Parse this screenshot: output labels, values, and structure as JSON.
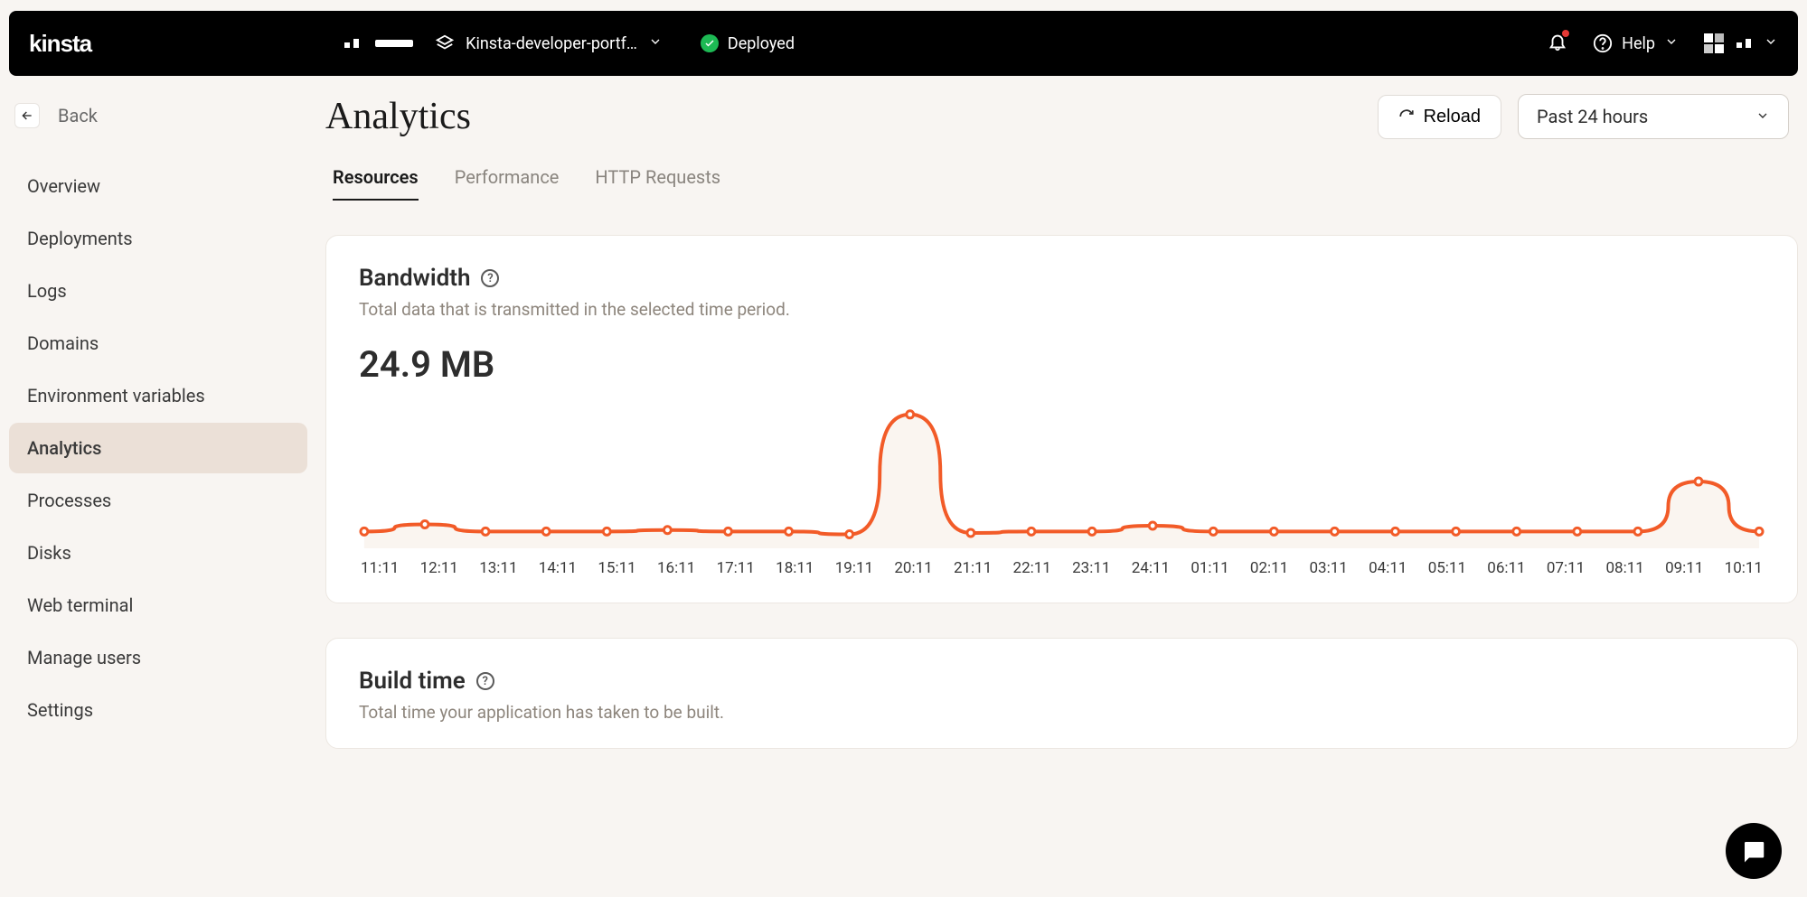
{
  "header": {
    "logo": "kinsta",
    "project_name": "Kinsta-developer-portf…",
    "status": "Deployed",
    "help_label": "Help"
  },
  "back_label": "Back",
  "sidebar": {
    "items": [
      {
        "label": "Overview",
        "active": false
      },
      {
        "label": "Deployments",
        "active": false
      },
      {
        "label": "Logs",
        "active": false
      },
      {
        "label": "Domains",
        "active": false
      },
      {
        "label": "Environment variables",
        "active": false
      },
      {
        "label": "Analytics",
        "active": true
      },
      {
        "label": "Processes",
        "active": false
      },
      {
        "label": "Disks",
        "active": false
      },
      {
        "label": "Web terminal",
        "active": false
      },
      {
        "label": "Manage users",
        "active": false
      },
      {
        "label": "Settings",
        "active": false
      }
    ]
  },
  "page": {
    "title": "Analytics",
    "reload_label": "Reload",
    "range_label": "Past 24 hours"
  },
  "tabs": [
    {
      "label": "Resources",
      "active": true
    },
    {
      "label": "Performance",
      "active": false
    },
    {
      "label": "HTTP Requests",
      "active": false
    }
  ],
  "cards": {
    "bandwidth": {
      "title": "Bandwidth",
      "subtitle": "Total data that is transmitted in the selected time period.",
      "metric": "24.9 MB"
    },
    "buildtime": {
      "title": "Build time",
      "subtitle": "Total time your application has taken to be built."
    }
  },
  "chart_data": {
    "type": "line",
    "color": "#f25b28",
    "categories": [
      "11:11",
      "12:11",
      "13:11",
      "14:11",
      "15:11",
      "16:11",
      "17:11",
      "18:11",
      "19:11",
      "20:11",
      "21:11",
      "22:11",
      "23:11",
      "24:11",
      "01:11",
      "02:11",
      "03:11",
      "04:11",
      "05:11",
      "06:11",
      "07:11",
      "08:11",
      "09:11",
      "10:11"
    ],
    "values": [
      0.8,
      1.3,
      0.8,
      0.8,
      0.8,
      0.9,
      0.8,
      0.8,
      0.6,
      9.0,
      0.7,
      0.8,
      0.8,
      1.2,
      0.8,
      0.8,
      0.8,
      0.8,
      0.8,
      0.8,
      0.8,
      0.8,
      4.3,
      0.8
    ],
    "ylim": [
      0,
      10
    ],
    "title": "",
    "xlabel": "",
    "ylabel": ""
  }
}
